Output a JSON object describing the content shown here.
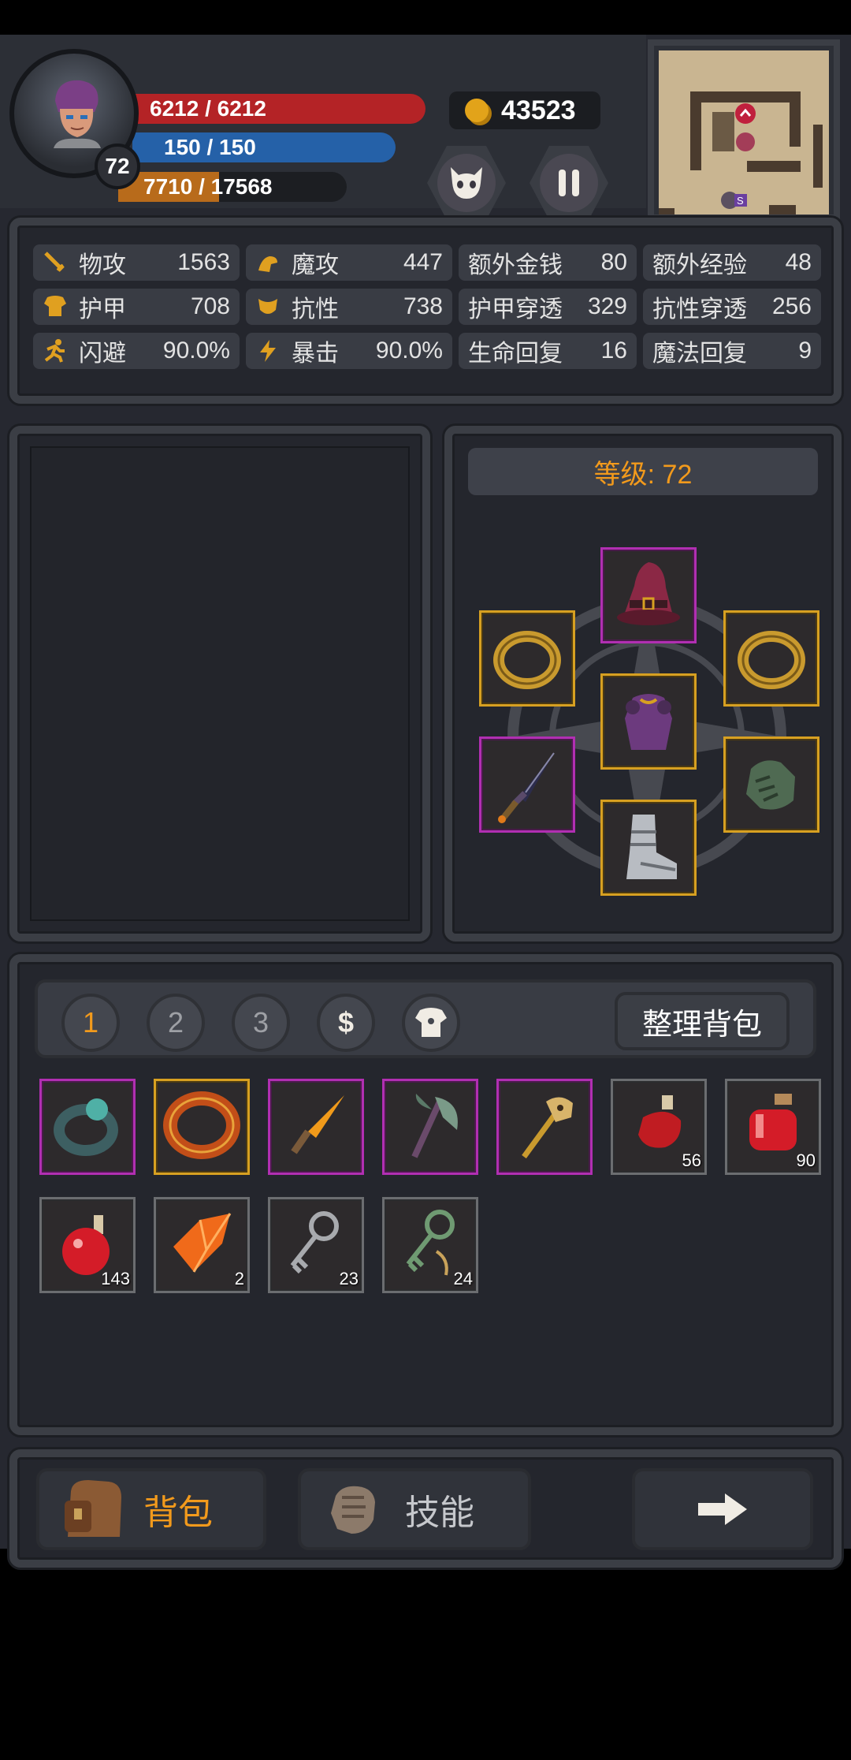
{
  "hud": {
    "level": "72",
    "hp": "6212 / 6212",
    "mp": "150 / 150",
    "xp": "7710 / 17568",
    "xp_fraction": 0.44,
    "gold": "43523"
  },
  "stats": [
    {
      "name": "物攻",
      "value": "1563",
      "icon": "sword-icon"
    },
    {
      "name": "魔攻",
      "value": "447",
      "icon": "magic-hand-icon"
    },
    {
      "name": "额外金钱",
      "value": "80",
      "icon": ""
    },
    {
      "name": "额外经验",
      "value": "48",
      "icon": ""
    },
    {
      "name": "护甲",
      "value": "708",
      "icon": "armor-icon"
    },
    {
      "name": "抗性",
      "value": "738",
      "icon": "resist-icon"
    },
    {
      "name": "护甲穿透",
      "value": "329",
      "icon": ""
    },
    {
      "name": "抗性穿透",
      "value": "256",
      "icon": ""
    },
    {
      "name": "闪避",
      "value": "90.0%",
      "icon": "dodge-icon"
    },
    {
      "name": "暴击",
      "value": "90.0%",
      "icon": "lightning-icon"
    },
    {
      "name": "生命回复",
      "value": "16",
      "icon": ""
    },
    {
      "name": "魔法回复",
      "value": "9",
      "icon": ""
    }
  ],
  "equipment": {
    "level_label": "等级: 72"
  },
  "bag": {
    "tabs": [
      "1",
      "2",
      "3",
      "$",
      "armor"
    ],
    "sort_label": "整理背包",
    "items": [
      {
        "name": "ring-icon",
        "qty": "",
        "border": "purple"
      },
      {
        "name": "lava-ring-icon",
        "qty": "",
        "border": "gold"
      },
      {
        "name": "dagger-icon",
        "qty": "",
        "border": "purple"
      },
      {
        "name": "axe-icon",
        "qty": "",
        "border": "purple"
      },
      {
        "name": "skull-staff-icon",
        "qty": "",
        "border": "purple"
      },
      {
        "name": "red-potion-icon",
        "qty": "56",
        "border": "gray"
      },
      {
        "name": "red-jar-icon",
        "qty": "90",
        "border": "gray"
      },
      {
        "name": "round-flask-icon",
        "qty": "143",
        "border": "gray"
      },
      {
        "name": "orange-crystal-icon",
        "qty": "2",
        "border": "gray"
      },
      {
        "name": "silver-key-icon",
        "qty": "23",
        "border": "gray"
      },
      {
        "name": "green-key-icon",
        "qty": "24",
        "border": "gray"
      }
    ]
  },
  "nav": {
    "bag_label": "背包",
    "skills_label": "技能"
  }
}
